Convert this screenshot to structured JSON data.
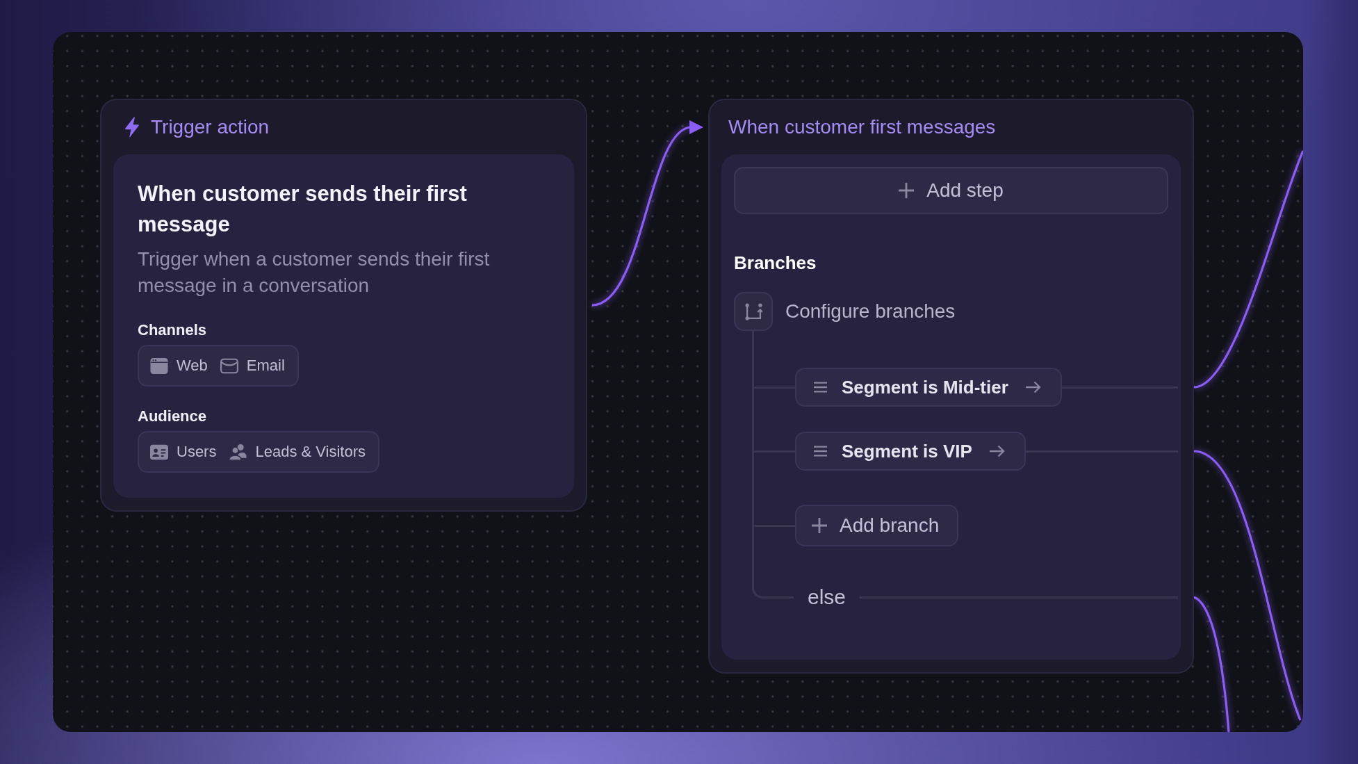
{
  "nodes": [
    {
      "kind": "trigger",
      "header": "Trigger action",
      "title": "When customer sends their first message",
      "description": "Trigger when a customer sends their first message in a conversation",
      "sections": [
        {
          "label": "Channels",
          "chips": [
            {
              "kind": "web",
              "label": "Web"
            },
            {
              "kind": "email",
              "label": "Email"
            }
          ]
        },
        {
          "label": "Audience",
          "chips": [
            {
              "kind": "users",
              "label": "Users"
            },
            {
              "kind": "leads",
              "label": "Leads & Visitors"
            }
          ]
        }
      ]
    },
    {
      "kind": "branch",
      "header": "When customer first messages",
      "add_step": "Add step",
      "branches_heading": "Branches",
      "configure": "Configure branches",
      "branches": [
        {
          "label": "Segment is Mid-tier"
        },
        {
          "label": "Segment is VIP"
        }
      ],
      "add_branch": "Add branch",
      "else_label": "else"
    }
  ]
}
